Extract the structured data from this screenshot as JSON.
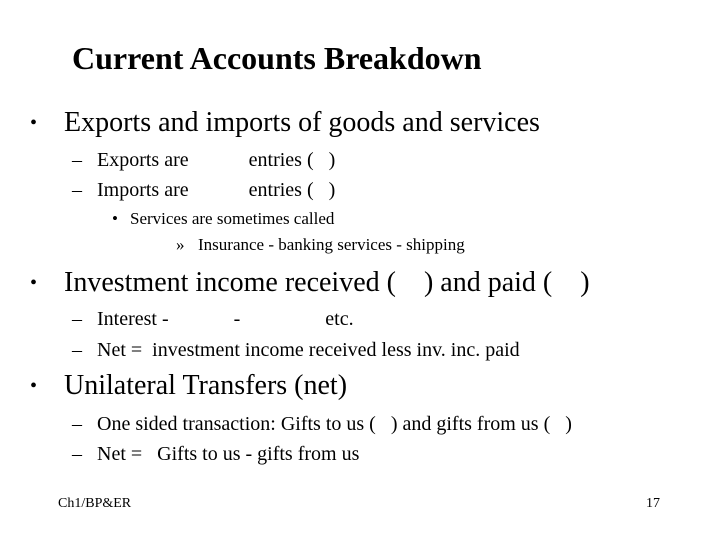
{
  "slide": {
    "title": "Current Accounts Breakdown",
    "sections": [
      {
        "bullet": "•",
        "text": "Exports and imports of goods and services",
        "items": [
          {
            "bullet": "–",
            "text": "Exports are            entries (   )"
          },
          {
            "bullet": "–",
            "text": "Imports are            entries (   )"
          }
        ],
        "sub": {
          "bullet": "•",
          "text": "Services are sometimes called",
          "items": [
            {
              "bullet": "»",
              "text": "Insurance - banking services - shipping"
            }
          ]
        }
      },
      {
        "bullet": "•",
        "text": "Investment income received (    ) and paid (    )",
        "items": [
          {
            "bullet": "–",
            "text": "Interest -             -                 etc."
          },
          {
            "bullet": "–",
            "text": "Net =  investment income received less inv. inc. paid"
          }
        ]
      },
      {
        "bullet": "•",
        "text": "Unilateral Transfers (net)",
        "items": [
          {
            "bullet": "–",
            "text": "One sided transaction: Gifts to us (   ) and gifts from us (   )"
          },
          {
            "bullet": "–",
            "text": "Net =   Gifts to us - gifts from us"
          }
        ]
      }
    ],
    "footer": {
      "left": "Ch1/BP&ER",
      "page_number": "17"
    }
  }
}
